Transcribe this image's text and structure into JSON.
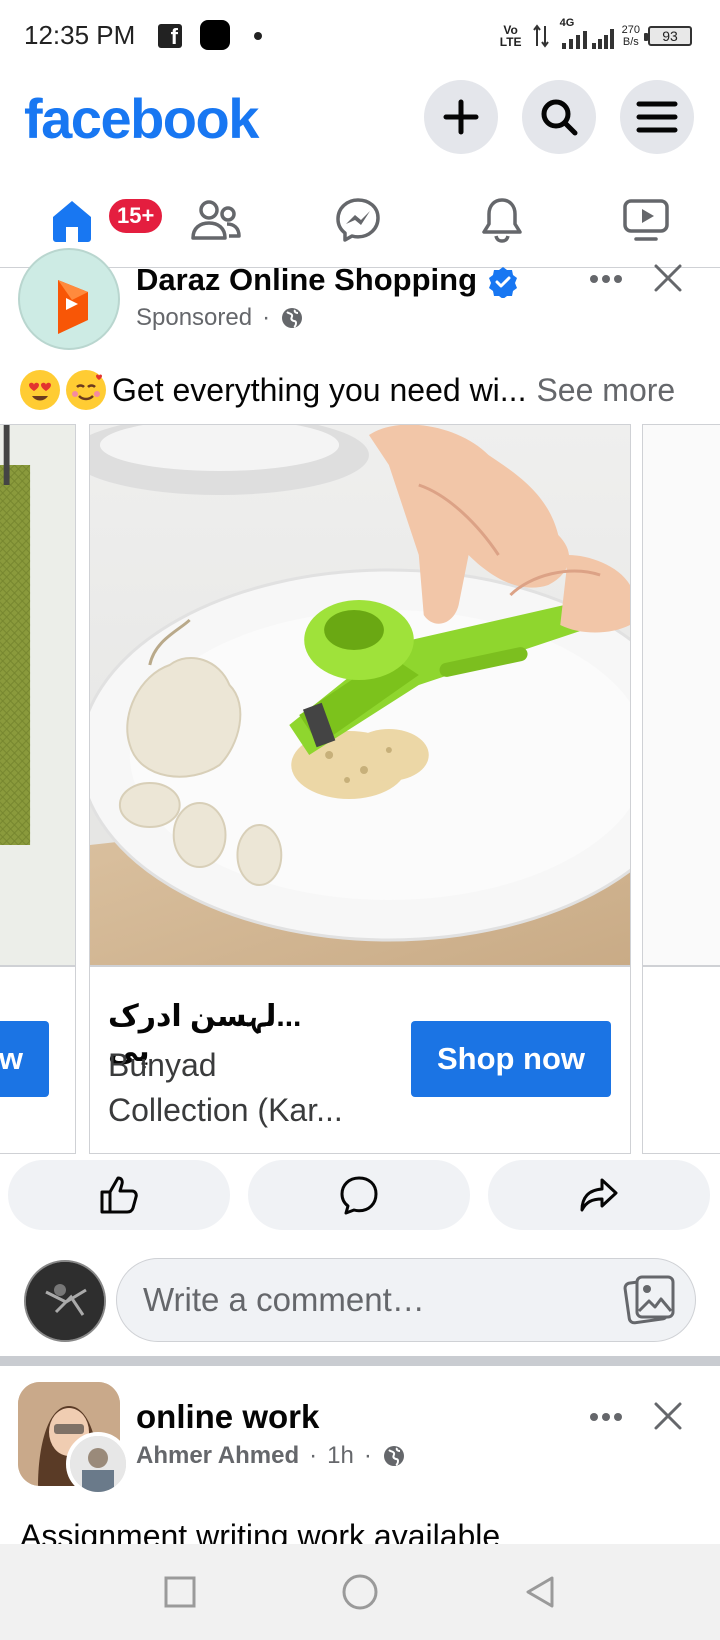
{
  "status_bar": {
    "time": "12:35 PM",
    "volte": "Vo LTE",
    "network": "4G",
    "speed_value": "270",
    "speed_unit": "B/s",
    "battery": "93"
  },
  "header": {
    "logo": "facebook",
    "icons": [
      "plus-icon",
      "search-icon",
      "menu-icon"
    ]
  },
  "tabs": {
    "items": [
      {
        "name": "home",
        "icon": "home-icon",
        "active": true
      },
      {
        "name": "friends",
        "icon": "friends-icon"
      },
      {
        "name": "messenger",
        "icon": "messenger-icon"
      },
      {
        "name": "notifications",
        "icon": "bell-icon"
      },
      {
        "name": "video",
        "icon": "video-icon"
      }
    ],
    "home_badge": "15+"
  },
  "post1": {
    "author": "Daraz Online Shopping",
    "verified": true,
    "sponsored": "Sponsored",
    "text": "Get everything you need wi...",
    "see_more": "See more",
    "emojis": [
      "heart-eyes-emoji",
      "smiling-hearts-emoji"
    ]
  },
  "carousel": {
    "left_button_partial": "ow",
    "card": {
      "title": "...لہسن ادرک پی",
      "subtitle_line1": "Bunyad",
      "subtitle_line2": "Collection (Kar...",
      "button": "Shop now"
    }
  },
  "actions": [
    "like-icon",
    "comment-icon",
    "share-icon"
  ],
  "comment": {
    "placeholder": "Write a comment…"
  },
  "post2": {
    "title": "online work",
    "author": "Ahmer Ahmed",
    "time": "1h",
    "text": "Assignment writing work available"
  },
  "colors": {
    "brand": "#1877f2",
    "button": "#1b74e4",
    "badge": "#e41e3f",
    "secondary_text": "#65676b",
    "surface": "#f0f2f5"
  }
}
